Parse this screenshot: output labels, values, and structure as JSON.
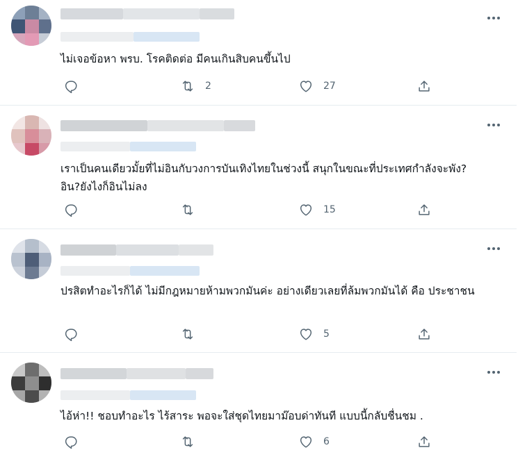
{
  "icons": {
    "more": "more-dots-icon",
    "reply": "reply-icon",
    "retweet": "retweet-icon",
    "like": "heart-icon",
    "share": "share-icon"
  },
  "colors": {
    "icon_gray": "#536471",
    "divider": "#e6ecf0",
    "text": "#0f1419"
  },
  "tweets": [
    {
      "text": "ไม่เจอข้อหา พรบ. โรคติดต่อ มีคนเกินสิบคนขึ้นไป",
      "reply_count": "",
      "retweet_count": "2",
      "like_count": "27"
    },
    {
      "text": "เราเป็นคนเดียวมั้ยที่ไม่อินกับวงการบันเทิงไทยในช่วงนี้ สนุกในขณะที่ประเทศกำลังจะพัง? อิน?ยังไงก็อินไม่ลง",
      "reply_count": "",
      "retweet_count": "",
      "like_count": "15"
    },
    {
      "text": "ปรสิตทำอะไรก็ได้ ไม่มีกฎหมายห้ามพวกมันค่ะ อย่างเดียวเลยที่ล้มพวกมันได้ คือ ประชาชน",
      "reply_count": "",
      "retweet_count": "",
      "like_count": "5"
    },
    {
      "text": "ไอ้ห่า!! ชอบทำอะไร ไร้สาระ พอจะใส่ชุดไทยมาม๊อบด่าทันที แบบนี้กลับชื่นชม .",
      "reply_count": "",
      "retweet_count": "",
      "like_count": "6"
    }
  ]
}
